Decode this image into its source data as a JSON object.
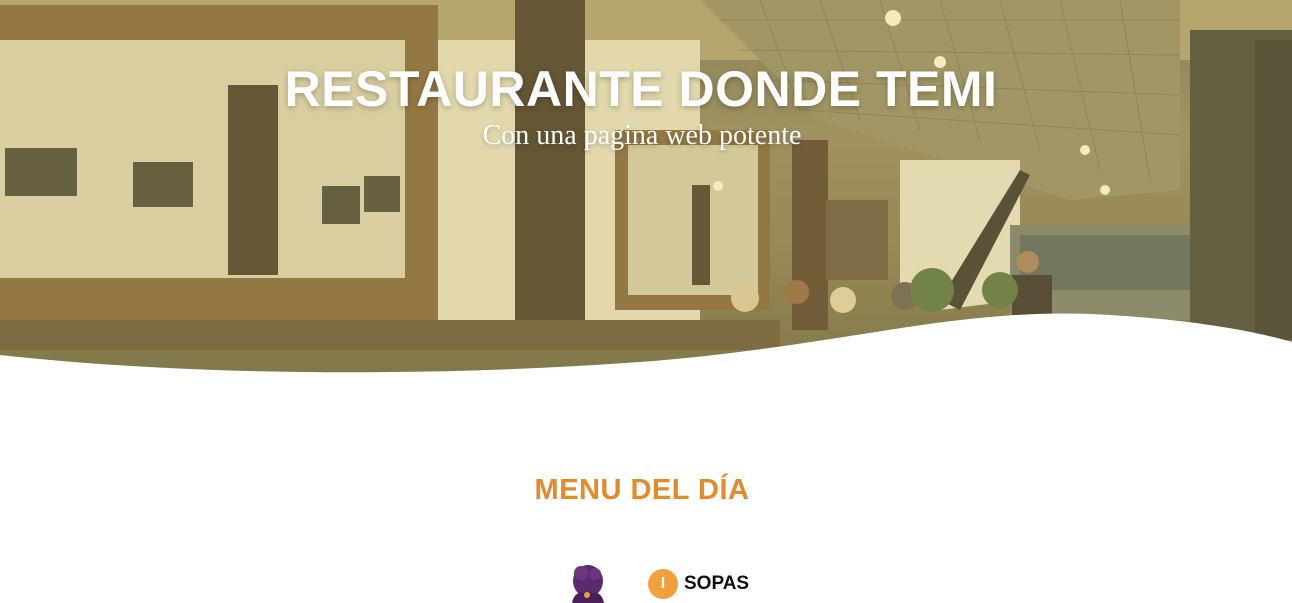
{
  "hero": {
    "title": "RESTAURANTE DONDE TEMI",
    "subtitle": "Con una pagina web potente",
    "overlay_color": "#d6c46e"
  },
  "menu": {
    "heading": "MENU DEL DÍA",
    "heading_color": "#e38a2b",
    "items": [
      {
        "number": "I",
        "label": "SOPAS",
        "badge_color": "#f2a03c"
      }
    ]
  }
}
